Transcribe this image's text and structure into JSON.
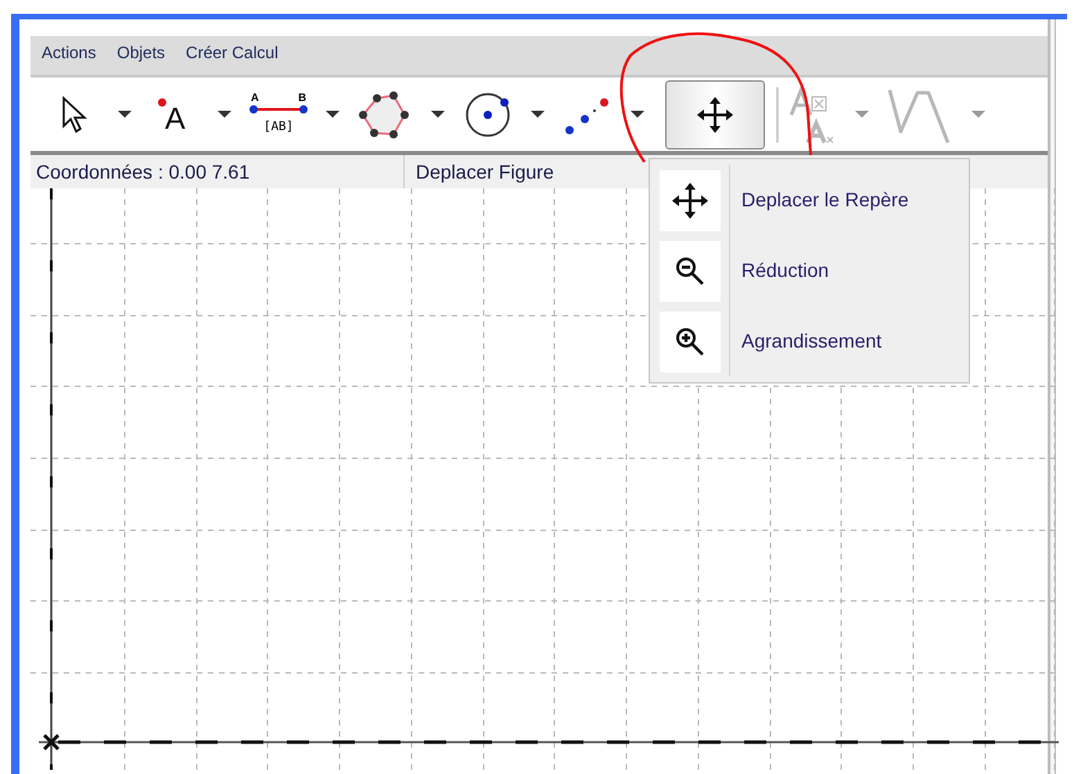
{
  "menu_bar": [
    {
      "label": "Actions"
    },
    {
      "label": "Objets"
    },
    {
      "label": "Créer Calcul"
    }
  ],
  "toolbar": [
    {
      "kind": "pointer",
      "selected": false,
      "disabled": false
    },
    {
      "kind": "point",
      "selected": false,
      "disabled": false,
      "label": "A"
    },
    {
      "kind": "segment",
      "selected": false,
      "disabled": false,
      "label": "[AB]",
      "end_labels": [
        "A",
        "B"
      ]
    },
    {
      "kind": "polygon",
      "selected": false,
      "disabled": false
    },
    {
      "kind": "circle",
      "selected": false,
      "disabled": false
    },
    {
      "kind": "points",
      "selected": false,
      "disabled": false
    },
    {
      "kind": "move",
      "selected": true,
      "disabled": false
    },
    {
      "kind": "text",
      "selected": false,
      "disabled": true
    },
    {
      "kind": "curve",
      "selected": false,
      "disabled": true
    }
  ],
  "status": {
    "coordinates": "Coordonnées : 0.00 7.61",
    "mode": "Deplacer Figure"
  },
  "popup_menu": [
    {
      "kind": "move",
      "label": "Deplacer le Repère"
    },
    {
      "kind": "zoom_out",
      "label": "Réduction"
    },
    {
      "kind": "zoom_in",
      "label": "Agrandissement"
    }
  ]
}
